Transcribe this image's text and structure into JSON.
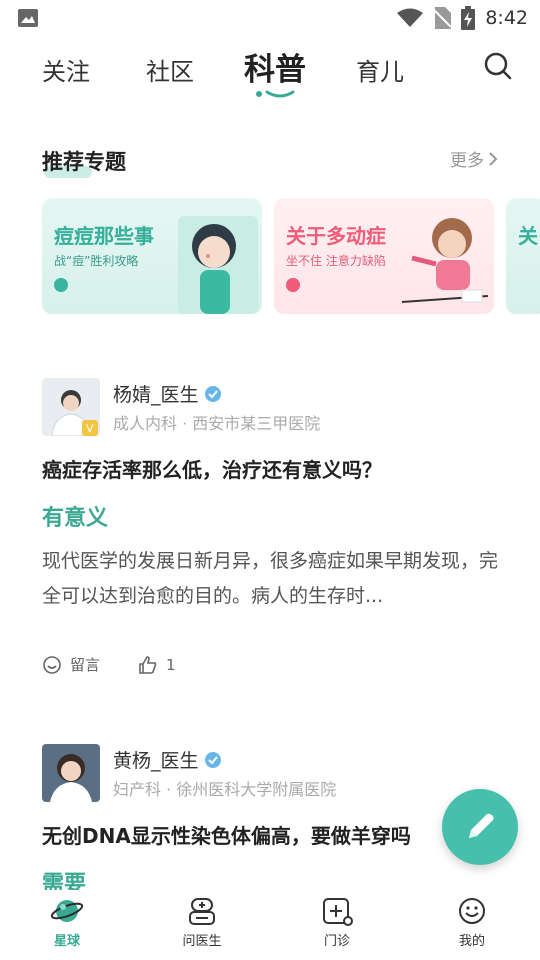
{
  "status_bar": {
    "time": "8:42"
  },
  "top_tabs": [
    {
      "label": "关注"
    },
    {
      "label": "社区"
    },
    {
      "label": "科普",
      "active": true
    },
    {
      "label": "育儿"
    }
  ],
  "recommended": {
    "title": "推荐专题",
    "more_label": "更多",
    "cards": [
      {
        "title": "痘痘那些事",
        "subtitle": "战“痘”胜利攻略"
      },
      {
        "title": "关于多动症",
        "subtitle": "坐不住 注意力缺陷"
      },
      {
        "title": "关"
      }
    ]
  },
  "posts": [
    {
      "author": "杨婧_医生",
      "dept": "成人内科 · 西安市某三甲医院",
      "title": "癌症存活率那么低，治疗还有意义吗？",
      "answer": "有意义",
      "excerpt": "现代医学的发展日新月异，很多癌症如果早期发现，完全可以达到治愈的目的。病人的生存时...",
      "comment_label": "留言",
      "likes": "1"
    },
    {
      "author": "黄杨_医生",
      "dept": "妇产科 · 徐州医科大学附属医院",
      "title": "无创DNA显示性染色体偏高，要做羊穿吗",
      "answer": "需要"
    }
  ],
  "bottom_nav": [
    {
      "label": "星球",
      "active": true
    },
    {
      "label": "问医生"
    },
    {
      "label": "门诊"
    },
    {
      "label": "我的"
    }
  ],
  "colors": {
    "accent": "#3aa993",
    "pink": "#ee5c78",
    "fab": "#46c0ac"
  }
}
